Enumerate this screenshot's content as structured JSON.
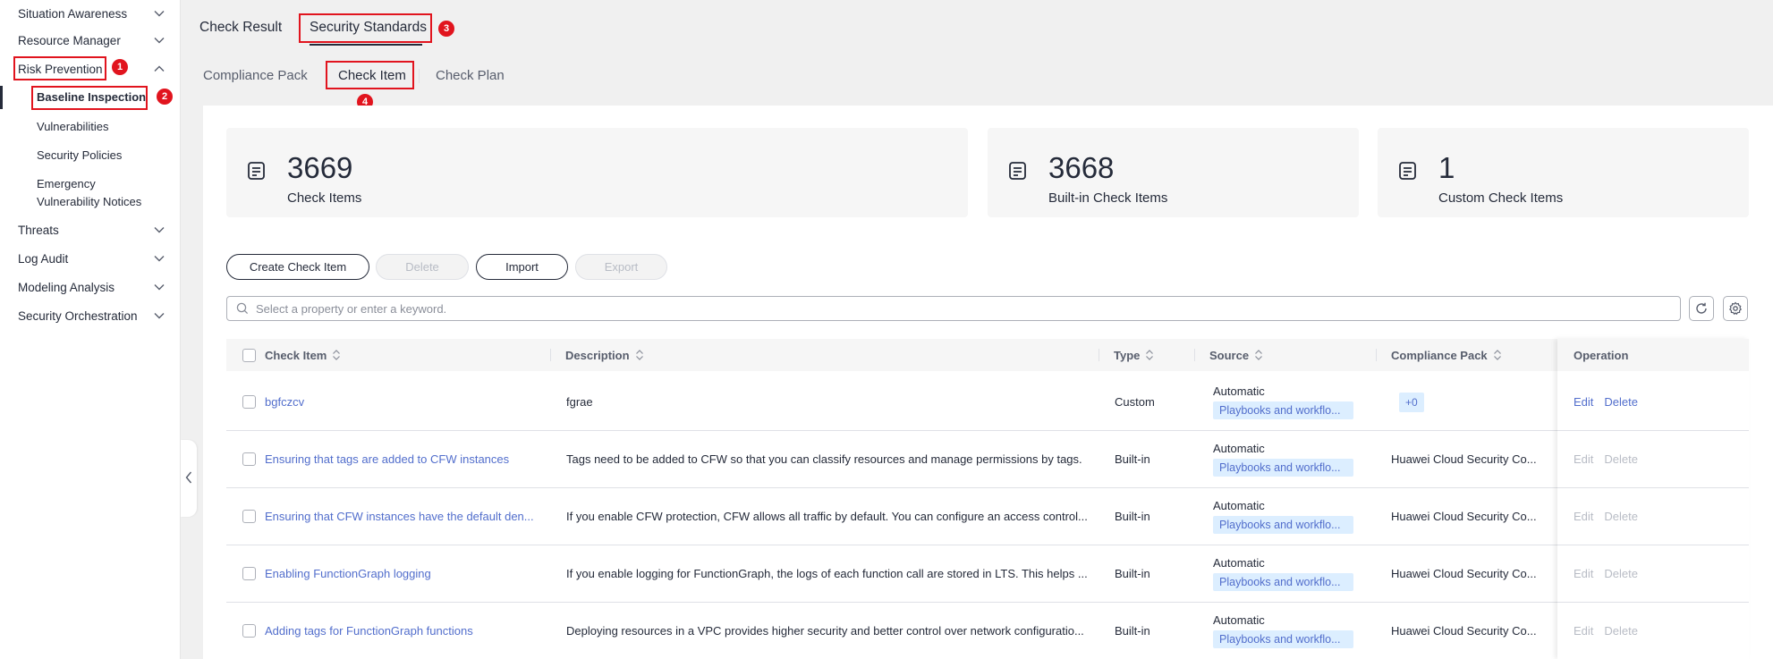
{
  "sidebar": {
    "groups": [
      {
        "label": "Situation Awareness"
      },
      {
        "label": "Resource Manager"
      },
      {
        "label": "Risk Prevention"
      },
      {
        "label": "Threats"
      },
      {
        "label": "Log Audit"
      },
      {
        "label": "Modeling Analysis"
      },
      {
        "label": "Security Orchestration"
      }
    ],
    "risk_items": [
      {
        "label": "Baseline Inspection"
      },
      {
        "label": "Vulnerabilities"
      },
      {
        "label": "Security Policies"
      },
      {
        "label": "Emergency"
      },
      {
        "label": "Vulnerability Notices"
      }
    ]
  },
  "annotations": [
    "1",
    "2",
    "3",
    "4"
  ],
  "top_tabs": [
    {
      "label": "Check Result"
    },
    {
      "label": "Security Standards"
    }
  ],
  "sub_tabs": [
    {
      "label": "Compliance Pack"
    },
    {
      "label": "Check Item"
    },
    {
      "label": "Check Plan"
    }
  ],
  "stats": [
    {
      "value": "3669",
      "label": "Check Items"
    },
    {
      "value": "3668",
      "label": "Built-in Check Items"
    },
    {
      "value": "1",
      "label": "Custom Check Items"
    }
  ],
  "toolbar": {
    "create": "Create Check Item",
    "delete": "Delete",
    "import": "Import",
    "export": "Export"
  },
  "search": {
    "placeholder": "Select a property or enter a keyword."
  },
  "table": {
    "columns": [
      "Check Item",
      "Description",
      "Type",
      "Source",
      "Compliance Pack",
      "Operation"
    ],
    "rows": [
      {
        "name": "bgfczcv",
        "description": "fgrae",
        "type": "Custom",
        "source": "Automatic",
        "source_tag": "Playbooks and workflo...",
        "pack": "+0",
        "edit": "Edit",
        "delete": "Delete"
      },
      {
        "name": "Ensuring that tags are added to CFW instances",
        "description": "Tags need to be added to CFW so that you can classify resources and manage permissions by tags.",
        "type": "Built-in",
        "source": "Automatic",
        "source_tag": "Playbooks and workflo...",
        "pack": "Huawei Cloud Security Co...",
        "edit": "Edit",
        "delete": "Delete"
      },
      {
        "name": "Ensuring that CFW instances have the default den...",
        "description": "If you enable CFW protection, CFW allows all traffic by default. You can configure an access control...",
        "type": "Built-in",
        "source": "Automatic",
        "source_tag": "Playbooks and workflo...",
        "pack": "Huawei Cloud Security Co...",
        "edit": "Edit",
        "delete": "Delete"
      },
      {
        "name": "Enabling FunctionGraph logging",
        "description": "If you enable logging for FunctionGraph, the logs of each function call are stored in LTS. This helps ...",
        "type": "Built-in",
        "source": "Automatic",
        "source_tag": "Playbooks and workflo...",
        "pack": "Huawei Cloud Security Co...",
        "edit": "Edit",
        "delete": "Delete"
      },
      {
        "name": "Adding tags for FunctionGraph functions",
        "description": "Deploying resources in a VPC provides higher security and better control over network configuratio...",
        "type": "Built-in",
        "source": "Automatic",
        "source_tag": "Playbooks and workflo...",
        "pack": "Huawei Cloud Security Co...",
        "edit": "Edit",
        "delete": "Delete"
      }
    ]
  },
  "colors": {
    "accent": "#526ecc",
    "annotation": "#e1141e",
    "tag_bg": "#dceeff"
  }
}
